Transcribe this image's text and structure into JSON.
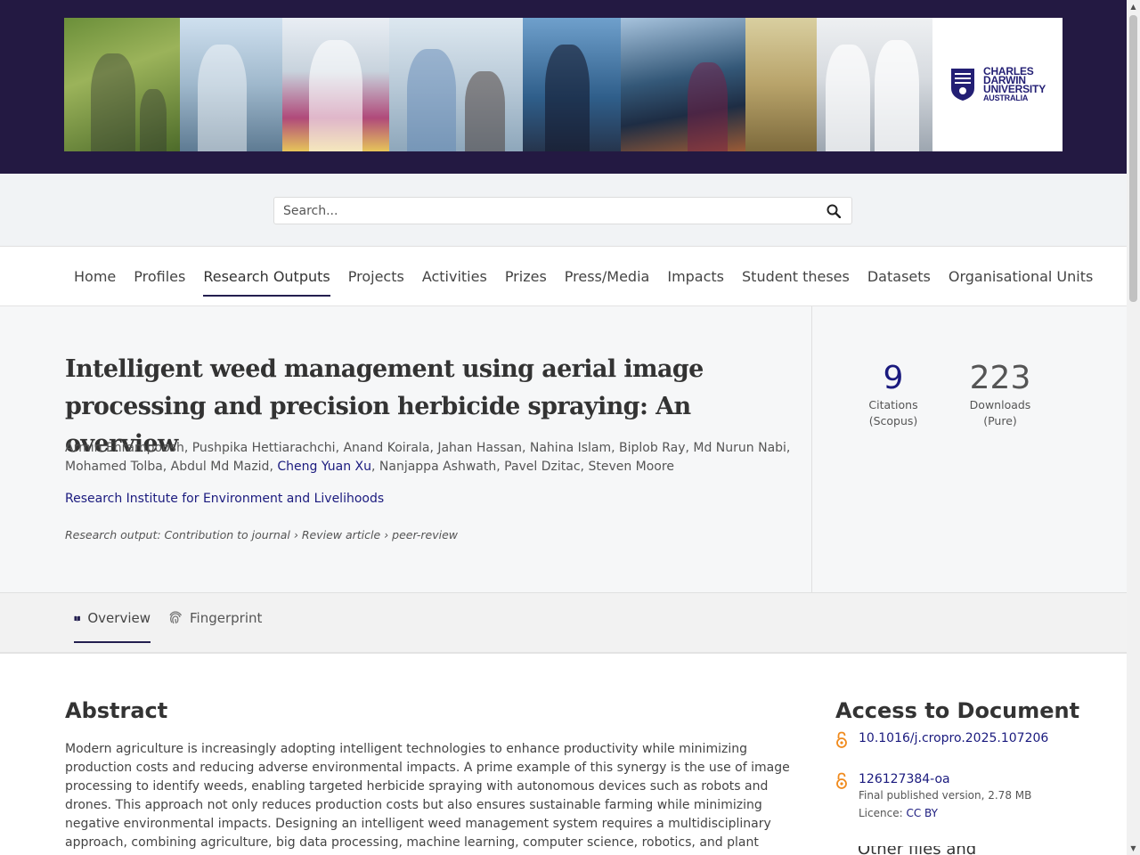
{
  "header": {
    "logo_line1": "CHARLES",
    "logo_line2": "DARWIN",
    "logo_line3": "UNIVERSITY",
    "logo_line4": "AUSTRALIA",
    "brand_color": "#231942"
  },
  "search": {
    "placeholder": "Search..."
  },
  "nav": {
    "items": [
      "Home",
      "Profiles",
      "Research Outputs",
      "Projects",
      "Activities",
      "Prizes",
      "Press/Media",
      "Impacts",
      "Student theses",
      "Datasets",
      "Organisational Units"
    ],
    "active": "Research Outputs"
  },
  "output": {
    "title": "Intelligent weed management using aerial image processing and precision herbicide spraying: An overview",
    "authors_before": "Armin Ehrampoosh, Pushpika Hettiarachchi, Anand Koirala, Jahan Hassan, Nahina Islam, Biplob Ray, Md Nurun Nabi, Mohamed Tolba, Abdul Md Mazid, ",
    "author_link": "Cheng Yuan Xu",
    "authors_after": ", Nanjappa Ashwath, Pavel Dzitac, Steven Moore",
    "organisation": "Research Institute for Environment and Livelihoods",
    "type": "Research output: Contribution to journal › Review article › peer-review"
  },
  "metrics": {
    "citations_value": "9",
    "citations_label1": "Citations",
    "citations_label2": "(Scopus)",
    "downloads_value": "223",
    "downloads_label1": "Downloads",
    "downloads_label2": "(Pure)"
  },
  "tabs": {
    "overview": "Overview",
    "fingerprint": "Fingerprint"
  },
  "abstract": {
    "heading": "Abstract",
    "text": "Modern agriculture is increasingly adopting intelligent technologies to enhance productivity while minimizing production costs and reducing adverse environmental impacts. A prime example of this synergy is the use of image processing to identify weeds, enabling targeted herbicide spraying with autonomous devices such as robots and drones. This approach not only reduces production costs but also ensures sustainable farming while minimizing negative environmental impacts. Designing an intelligent weed management system requires a multidisciplinary approach, combining agriculture, big data processing, machine learning, computer science, robotics, and plant science. Currently, independent studies have focused on some of"
  },
  "access": {
    "heading": "Access to Document",
    "doi": "10.1016/j.cropro.2025.107206",
    "file_name": "126127384-oa",
    "file_meta": "Final published version, 2.78 MB",
    "licence_label": "Licence: ",
    "licence_link": "CC BY",
    "next_heading": "Other files and links"
  }
}
